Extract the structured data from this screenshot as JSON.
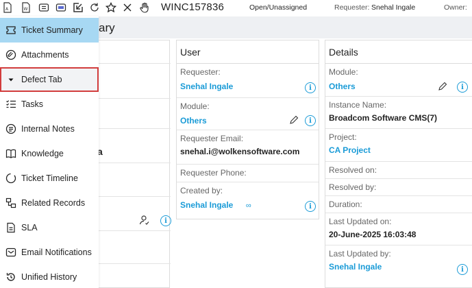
{
  "toolbar": {
    "icons": [
      "pdf-icon",
      "word-icon",
      "merge-icon",
      "ticket-icon",
      "export-icon",
      "refresh-icon",
      "star-icon",
      "close-icon",
      "hand-icon"
    ],
    "ticket_id": "WINC157836",
    "status": "Open/Unassigned",
    "requester_label": "Requester:",
    "requester_name": "Snehal Ingale",
    "owner_label": "Owner:"
  },
  "page": {
    "title_partial": "ary"
  },
  "sidebar": {
    "items": [
      {
        "label": "Ticket Summary",
        "icon": "ticket-icon",
        "state": "active"
      },
      {
        "label": "Attachments",
        "icon": "attachment-icon",
        "state": "normal"
      },
      {
        "label": "Defect Tab",
        "icon": "caret-down-icon",
        "state": "highlighted"
      },
      {
        "label": "Tasks",
        "icon": "tasks-icon",
        "state": "normal"
      },
      {
        "label": "Internal Notes",
        "icon": "notes-icon",
        "state": "normal"
      },
      {
        "label": "Knowledge",
        "icon": "book-icon",
        "state": "normal"
      },
      {
        "label": "Ticket Timeline",
        "icon": "timeline-icon",
        "state": "normal"
      },
      {
        "label": "Related Records",
        "icon": "related-icon",
        "state": "normal"
      },
      {
        "label": "SLA",
        "icon": "sla-icon",
        "state": "normal"
      },
      {
        "label": "Email Notifications",
        "icon": "email-icon",
        "state": "normal"
      },
      {
        "label": "Unified History",
        "icon": "history-icon",
        "state": "normal"
      }
    ]
  },
  "left_card": {
    "partial_text": "a"
  },
  "user_card": {
    "title": "User",
    "requester_label": "Requester:",
    "requester_value": "Snehal Ingale",
    "module_label": "Module:",
    "module_value": "Others",
    "email_label": "Requester Email:",
    "email_value": "snehal.i@wolkensoftware.com",
    "phone_label": "Requester Phone:",
    "created_label": "Created by:",
    "created_value": "Snehal Ingale"
  },
  "details_card": {
    "title": "Details",
    "module_label": "Module:",
    "module_value": "Others",
    "instance_label": "Instance Name:",
    "instance_value": "Broadcom Software CMS(7)",
    "project_label": "Project:",
    "project_value": "CA Project",
    "resolved_on_label": "Resolved on:",
    "resolved_by_label": "Resolved by:",
    "duration_label": "Duration:",
    "last_updated_on_label": "Last Updated on:",
    "last_updated_on_value": "20-June-2025 16:03:48",
    "last_updated_by_label": "Last Updated by:",
    "last_updated_by_value": "Snehal Ingale"
  },
  "colors": {
    "accent": "#1a9bd7",
    "active_bg": "#a7d8f3",
    "highlight_border": "#d23c3c"
  }
}
